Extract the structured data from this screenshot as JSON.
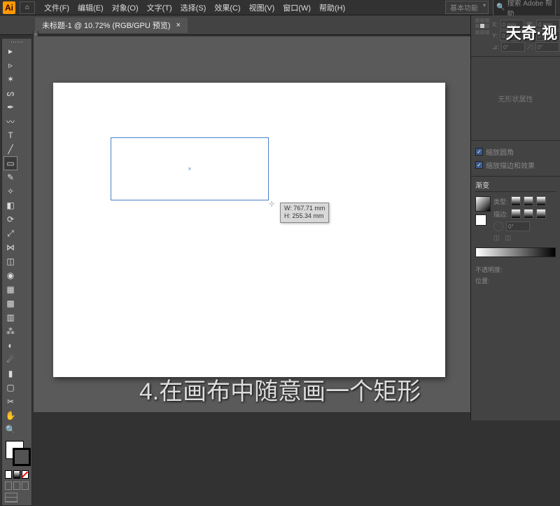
{
  "app": {
    "logo_letter": "Ai"
  },
  "menu": {
    "file": "文件(F)",
    "edit": "编辑(E)",
    "object": "对象(O)",
    "type": "文字(T)",
    "select": "选择(S)",
    "effect": "效果(C)",
    "view": "视图(V)",
    "window": "窗口(W)",
    "help": "帮助(H)"
  },
  "workspace_dropdown": "基本功能",
  "search_placeholder": "搜索 Adobe  帮助",
  "tab": {
    "title": "未标题-1 @ 10.72% (RGB/GPU 预览)",
    "close": "×"
  },
  "tooltip": {
    "w_label": "W:",
    "w_value": "767.71 mm",
    "h_label": "H:",
    "h_value": "255.34 mm"
  },
  "panels": {
    "transform": {
      "x_label": "X:",
      "x_value": "0 mm",
      "w_label": "宽:",
      "w_value": "0 mm",
      "y_label": "Y:",
      "y_value": "0 mm",
      "h_label": "高:",
      "h_value": "0 mm",
      "angle_label": "⊿:",
      "angle_value": "0°",
      "shear_value": "0°"
    },
    "shape_props": "无形状属性",
    "scale_corners": "缩放圆角",
    "scale_strokes": "缩放描边和效果",
    "gradient": {
      "tab": "渐变",
      "type_label": "类型:",
      "stroke_label": "描边:",
      "angle_value": "0°",
      "link_a": "◫",
      "link_b": "◫"
    },
    "transparency": {
      "opacity_label": "不透明度:",
      "position_label": "位置:"
    }
  },
  "watermark": "天奇·视",
  "caption": "4.在画布中随意画一个矩形",
  "icons": {
    "home": "⌂",
    "search": "🔍",
    "center_mark": "×",
    "drag": "⊹",
    "check": "✓"
  }
}
